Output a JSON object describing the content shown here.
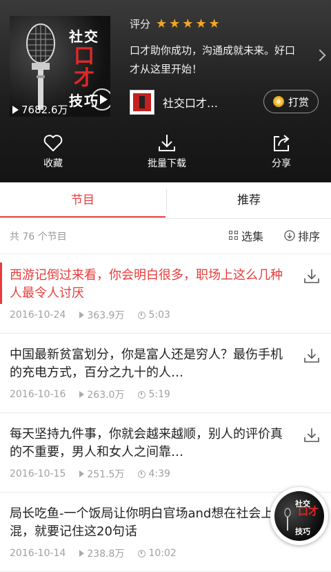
{
  "album": {
    "cover_title": [
      "社交",
      "口",
      "才",
      "技巧"
    ],
    "play_count": "7682.6万",
    "rating_label": "评分",
    "stars": 5,
    "description": "口才助你成功，沟通成就未来。好口才从这里开始！",
    "author_name": "社交口才…",
    "tip_label": "打赏"
  },
  "actions": [
    {
      "label": "收藏",
      "icon": "heart-icon"
    },
    {
      "label": "批量下载",
      "icon": "download-icon"
    },
    {
      "label": "分享",
      "icon": "share-icon"
    }
  ],
  "tabs": [
    {
      "label": "节目",
      "active": true
    },
    {
      "label": "推荐",
      "active": false
    }
  ],
  "list": {
    "count_text": "共 76 个节目",
    "select_label": "选集",
    "sort_label": "排序"
  },
  "episodes": [
    {
      "title": "西游记倒过来看，你会明白很多，职场上这么几种人最令人讨厌",
      "date": "2016-10-24",
      "plays": "363.9万",
      "duration": "5:03",
      "active": true
    },
    {
      "title": "中国最新贫富划分，你是富人还是穷人？最伤手机的充电方式，百分之九十的人…",
      "date": "2016-10-16",
      "plays": "263.0万",
      "duration": "5:19",
      "active": false
    },
    {
      "title": "每天坚持九件事，你就会越来越顺，别人的评价真的不重要，男人和女人之间靠…",
      "date": "2016-10-15",
      "plays": "251.5万",
      "duration": "4:39",
      "active": false
    },
    {
      "title": "局长吃鱼-一个饭局让你明白官场and想在社会上混，就要记住这20句话",
      "date": "2016-10-14",
      "plays": "238.8万",
      "duration": "10:02",
      "active": false
    }
  ],
  "mini_player": {
    "title": [
      "社交",
      "口才",
      "技巧"
    ]
  },
  "colors": {
    "accent": "#e83b3b",
    "star": "#f5a623",
    "header_bg": "#1e1e1e"
  }
}
